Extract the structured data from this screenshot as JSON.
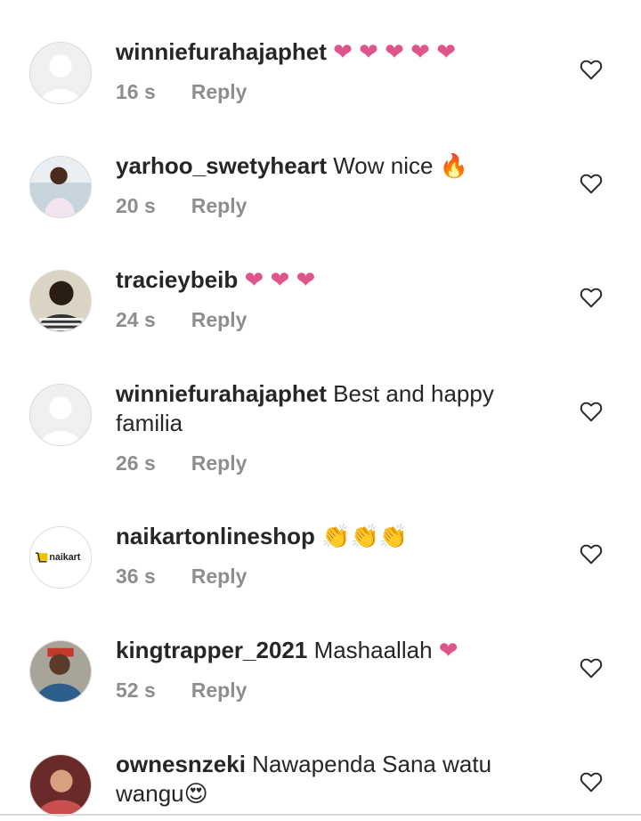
{
  "comments": [
    {
      "username": "winniefurahajaphet",
      "text": "",
      "emoji": "❤ ❤ ❤ ❤ ❤",
      "time": "16 s",
      "reply": "Reply",
      "avatar": "default-avatar"
    },
    {
      "username": "yarhoo_swetyheart",
      "text": "Wow nice",
      "emoji": "🔥",
      "time": "20 s",
      "reply": "Reply",
      "avatar": "photo-avatar"
    },
    {
      "username": "tracieybeib",
      "text": "",
      "emoji": "❤ ❤ ❤",
      "time": "24 s",
      "reply": "Reply",
      "avatar": "photo-avatar"
    },
    {
      "username": "winniefurahajaphet",
      "text": "Best and happy familia",
      "emoji": "",
      "time": "26 s",
      "reply": "Reply",
      "avatar": "default-avatar"
    },
    {
      "username": "naikartonlineshop",
      "text": "",
      "emoji": "👏👏👏",
      "time": "36 s",
      "reply": "Reply",
      "avatar": "naikart-logo"
    },
    {
      "username": "kingtrapper_2021",
      "text": "Mashaallah",
      "emoji": "❤",
      "time": "52 s",
      "reply": "Reply",
      "avatar": "photo-avatar"
    },
    {
      "username": "ownesnzeki",
      "text": "Nawapenda Sana watu wangu",
      "emoji": "😍",
      "time": "",
      "reply": "",
      "avatar": "photo-avatar"
    }
  ],
  "naikart_logo_text": "naikart",
  "colors": {
    "heart": "#e0548c",
    "meta": "#8e8e8e",
    "text": "#262626"
  }
}
